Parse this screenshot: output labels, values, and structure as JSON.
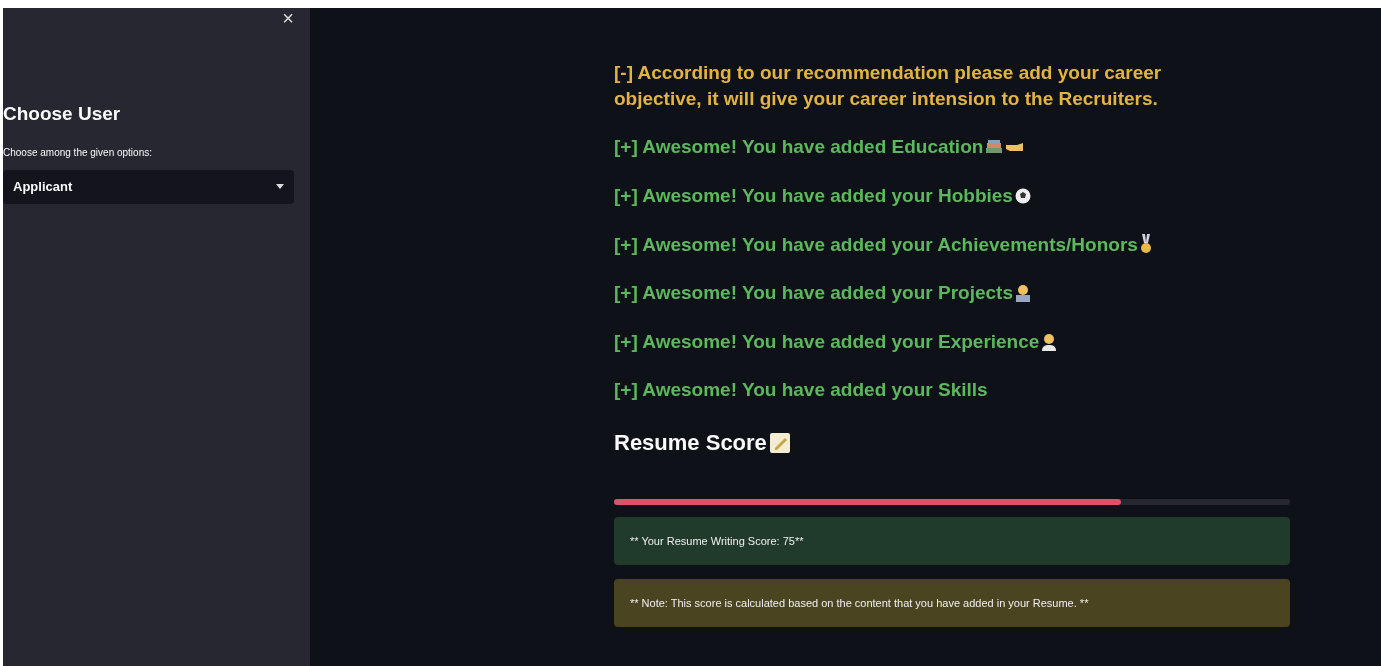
{
  "sidebar": {
    "close": "×",
    "title": "Choose User",
    "select_label": "Choose among the given options:",
    "select_value": "Applicant"
  },
  "messages": [
    {
      "kind": "warning",
      "text": "[-] According to our recommendation please add your career objective, it will give your career intension to the Recruiters."
    },
    {
      "kind": "success",
      "text": "[+] Awesome! You have added Education"
    },
    {
      "kind": "success",
      "text": "[+] Awesome! You have added your Hobbies"
    },
    {
      "kind": "success",
      "text": "[+] Awesome! You have added your Achievements/Honors"
    },
    {
      "kind": "success",
      "text": "[+] Awesome! You have added your Projects"
    },
    {
      "kind": "success",
      "text": "[+] Awesome! You have added your Experience"
    },
    {
      "kind": "success",
      "text": "[+] Awesome! You have added your Skills"
    }
  ],
  "score_heading": "Resume Score",
  "progress": {
    "level": 0.75
  },
  "alerts": [
    {
      "kind": "success",
      "text": "** Your Resume Writing Score: 75**"
    },
    {
      "kind": "warning",
      "text": "** Note: This score is calculated based on the content that you have added in your Resume. **"
    }
  ]
}
